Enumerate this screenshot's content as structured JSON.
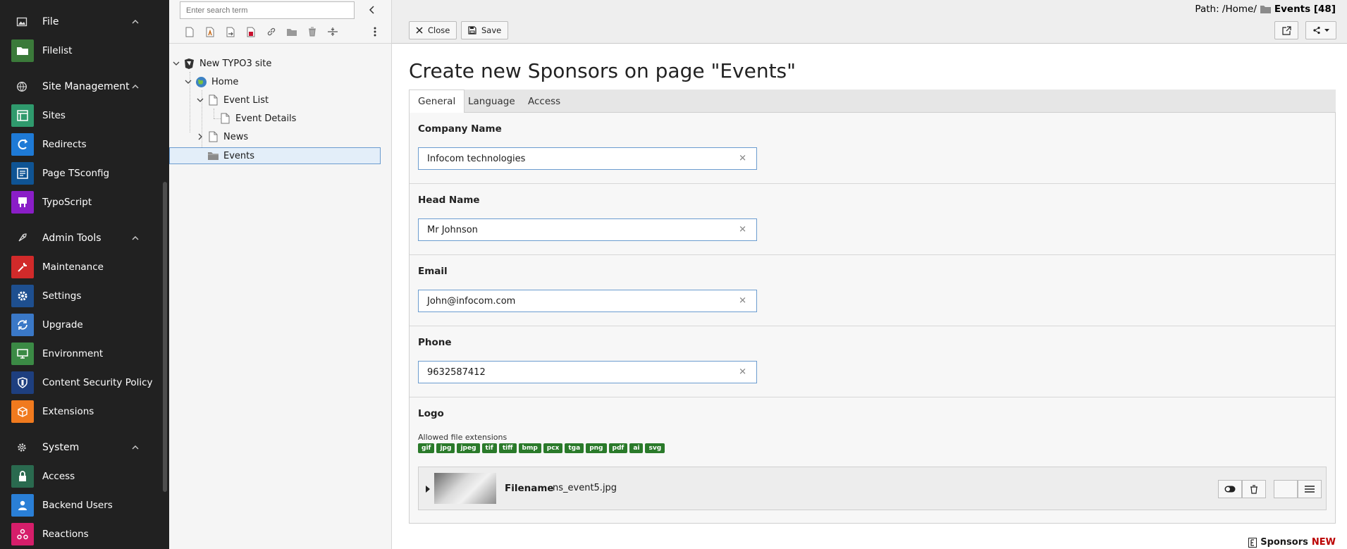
{
  "module_menu": {
    "groups": [
      {
        "label": "File",
        "icon": "image-icon",
        "items": [
          {
            "label": "Filelist",
            "icon": "folder-icon",
            "color": "#3b7a3a"
          }
        ]
      },
      {
        "label": "Site Management",
        "icon": "globe-icon",
        "items": [
          {
            "label": "Sites",
            "icon": "sites-icon",
            "color": "#2f9a6d"
          },
          {
            "label": "Redirects",
            "icon": "redirect-icon",
            "color": "#1e7ad6"
          },
          {
            "label": "Page TSconfig",
            "icon": "tsconfig-icon",
            "color": "#0f5494"
          },
          {
            "label": "TypoScript",
            "icon": "typoscript-icon",
            "color": "#8a1ec7"
          }
        ]
      },
      {
        "label": "Admin Tools",
        "icon": "rocket-icon",
        "items": [
          {
            "label": "Maintenance",
            "icon": "wrench-icon",
            "color": "#d12a2a"
          },
          {
            "label": "Settings",
            "icon": "gear-icon",
            "color": "#1e4f8f"
          },
          {
            "label": "Upgrade",
            "icon": "refresh-icon",
            "color": "#3a78c7"
          },
          {
            "label": "Environment",
            "icon": "monitor-icon",
            "color": "#3b8a45"
          },
          {
            "label": "Content Security Policy",
            "icon": "shield-icon",
            "color": "#1e3f7f"
          },
          {
            "label": "Extensions",
            "icon": "box-icon",
            "color": "#f07a1e"
          }
        ]
      },
      {
        "label": "System",
        "icon": "gear-icon",
        "items": [
          {
            "label": "Access",
            "icon": "lock-icon",
            "color": "#2a6a4f"
          },
          {
            "label": "Backend Users",
            "icon": "user-icon",
            "color": "#2a7fd6"
          },
          {
            "label": "Reactions",
            "icon": "reactions-icon",
            "color": "#d61e6a"
          }
        ]
      }
    ]
  },
  "tree": {
    "search_placeholder": "Enter search term",
    "nodes": [
      {
        "label": "New TYPO3 site"
      },
      {
        "label": "Home"
      },
      {
        "label": "Event List"
      },
      {
        "label": "Event Details"
      },
      {
        "label": "News"
      },
      {
        "label": "Events"
      }
    ]
  },
  "docheader": {
    "close_label": "Close",
    "save_label": "Save",
    "path_prefix": "Path: /Home/",
    "path_page": "Events [48]"
  },
  "page": {
    "title": "Create new Sponsors on page \"Events\"",
    "tabs": [
      "General",
      "Language",
      "Access"
    ]
  },
  "form": {
    "company_name": {
      "label": "Company Name",
      "value": "Infocom technologies"
    },
    "head_name": {
      "label": "Head Name",
      "value": "Mr Johnson"
    },
    "email": {
      "label": "Email",
      "value": "John@infocom.com"
    },
    "phone": {
      "label": "Phone",
      "value": "9632587412"
    },
    "logo": {
      "label": "Logo",
      "allowed_label": "Allowed file extensions",
      "extensions": [
        "gif",
        "jpg",
        "jpeg",
        "tif",
        "tiff",
        "bmp",
        "pcx",
        "tga",
        "png",
        "pdf",
        "ai",
        "svg"
      ],
      "filename_label": "Filename",
      "filename": "ns_event5.jpg"
    }
  },
  "footer": {
    "record_type": "Sponsors",
    "record_state": "NEW"
  },
  "colors": {
    "menu_bg": "#212121",
    "tree_selected_bg": "#e3eef9",
    "tree_selected_border": "#6b9ccf",
    "badge_green": "#2a7a2a",
    "new_red": "#b00000"
  }
}
